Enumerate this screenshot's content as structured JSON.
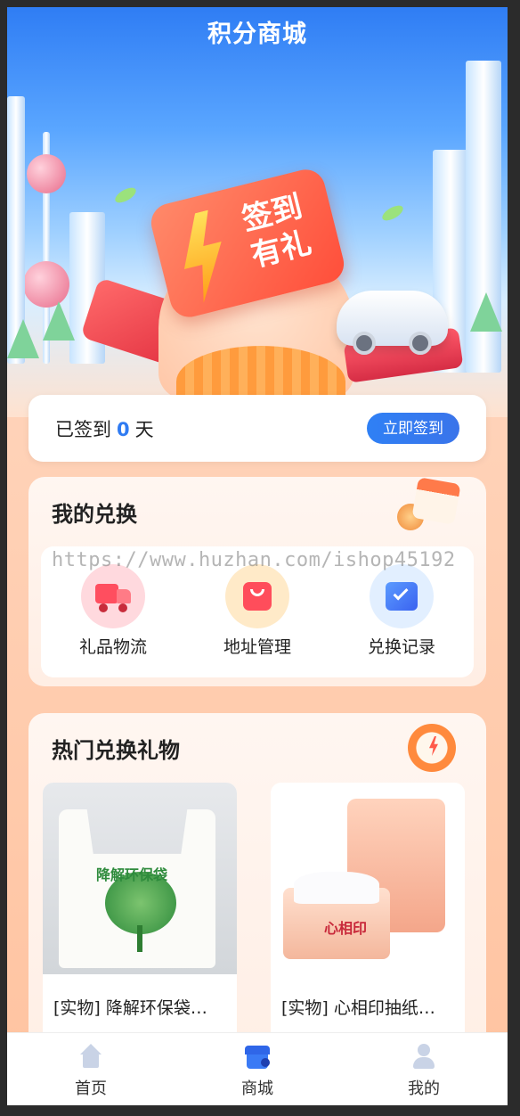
{
  "header": {
    "title": "积分商城"
  },
  "banner": {
    "card_text": "签到有礼",
    "card_line1": "签到",
    "card_line2": "有礼"
  },
  "signin": {
    "prefix": "已签到",
    "days": "0",
    "suffix": "天",
    "button": "立即签到"
  },
  "my_exchange": {
    "title": "我的兑换",
    "items": [
      {
        "label": "礼品物流",
        "icon": "truck-icon"
      },
      {
        "label": "地址管理",
        "icon": "bag-icon"
      },
      {
        "label": "兑换记录",
        "icon": "calendar-check-icon"
      }
    ]
  },
  "watermark": "https://www.huzhan.com/ishop45192",
  "hot_gifts": {
    "title": "热门兑换礼物",
    "products": [
      {
        "name": "[实物] 降解环保袋…",
        "bag_text": "降解环保袋"
      },
      {
        "name": "[实物] 心相印抽纸…",
        "brand": "心相印"
      }
    ]
  },
  "tabbar": {
    "tabs": [
      {
        "label": "首页",
        "icon": "home-icon"
      },
      {
        "label": "商城",
        "icon": "shop-icon"
      },
      {
        "label": "我的",
        "icon": "user-icon"
      }
    ]
  },
  "colors": {
    "primary": "#2f7bf2",
    "background": "#ffd3b9"
  }
}
